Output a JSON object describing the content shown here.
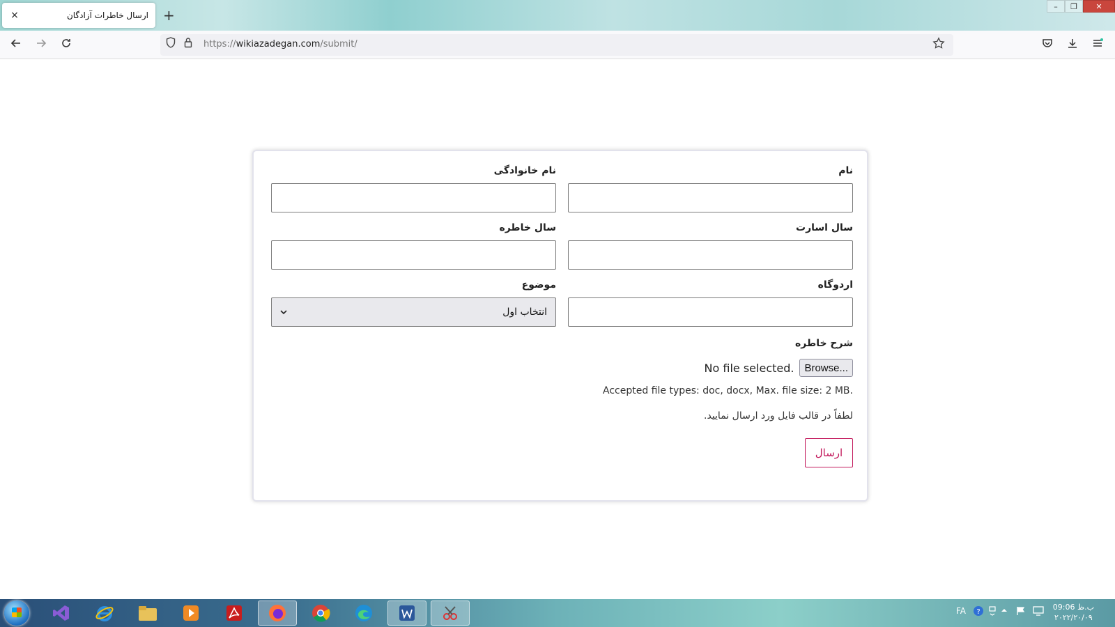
{
  "browser": {
    "tab_title": "ارسال خاطرات آزادگان",
    "tab_close": "×",
    "new_tab": "+",
    "url_prefix": "https://",
    "url_domain": "wikiazadegan.com",
    "url_path": "/submit/",
    "window_controls": [
      "–",
      "❐",
      "✕"
    ]
  },
  "form": {
    "first_name_label": "نام",
    "last_name_label": "نام خانوادگی",
    "captivity_year_label": "سال اسارت",
    "memory_year_label": "سال خاطره",
    "camp_label": "اردوگاه",
    "topic_label": "موضوع",
    "topic_selected": "انتخاب اول",
    "description_label": "شرح خاطره",
    "browse_label": "Browse...",
    "no_file_text": "No file selected.",
    "accepted_types": "Accepted file types: doc, docx, Max. file size: 2 MB.",
    "word_hint": "لطفاً در قالب فایل ورد ارسال نمایید.",
    "submit_label": "ارسال"
  },
  "taskbar": {
    "language": "FA",
    "time": "09:06 ب.ظ",
    "date": "۲۰۲۲/۲۰/۰۹"
  }
}
